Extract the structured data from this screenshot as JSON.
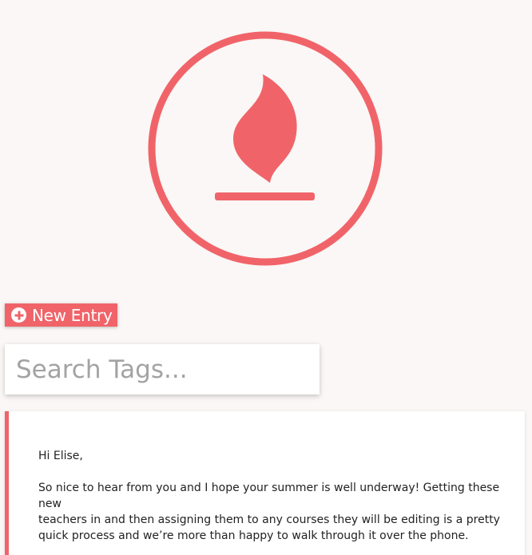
{
  "brand": {
    "logo_icon": "flame-icon",
    "accent_color": "#f06469"
  },
  "toolbar": {
    "new_entry_icon": "plus-circle-icon",
    "new_entry_label": "New Entry"
  },
  "search": {
    "placeholder": "Search Tags...",
    "value": ""
  },
  "entry": {
    "greeting": "Hi Elise,",
    "lines": [
      "So nice to hear from you and I hope your summer is well underway! Getting these new",
      "teachers in and then assigning them to any courses they will be editing is a pretty",
      "quick process and we’re more than happy to walk through it over the phone."
    ]
  }
}
